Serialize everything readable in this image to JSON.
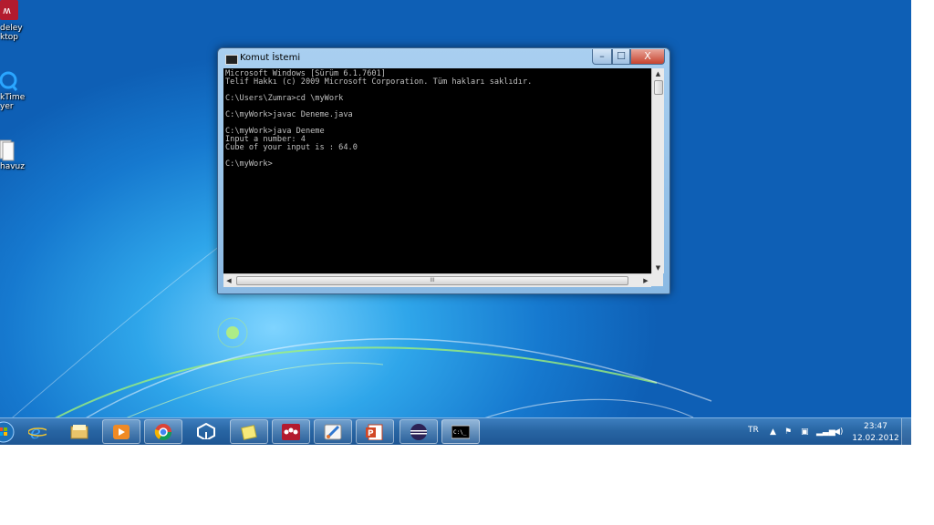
{
  "desktop_icons": [
    {
      "label": "deley\nktop",
      "icon": "mendeley-desktop-icon"
    },
    {
      "label": "kTime\nyer",
      "icon": "quicktime-player-icon"
    },
    {
      "label": "havuz",
      "icon": "folder-icon"
    }
  ],
  "window": {
    "title": "Komut İstemi",
    "icon": "console-icon",
    "console_text": "Microsoft Windows [Sürüm 6.1.7601]\nTelif Hakkı (c) 2009 Microsoft Corporation. Tüm hakları saklıdır.\n\nC:\\Users\\Zumra>cd \\myWork\n\nC:\\myWork>javac Deneme.java\n\nC:\\myWork>java Deneme\nInput a number: 4\nCube of your input is : 64.0\n\nC:\\myWork>",
    "controls": {
      "minimize": "–",
      "maximize": "☐",
      "close": "X"
    },
    "scroll": {
      "up": "▲",
      "down": "▼",
      "left": "◀",
      "right": "▶",
      "grip": "III"
    }
  },
  "taskbar": {
    "pinned": [
      {
        "name": "start-button"
      },
      {
        "name": "internet-explorer"
      },
      {
        "name": "windows-explorer"
      },
      {
        "name": "media-player"
      },
      {
        "name": "google-chrome"
      },
      {
        "name": "unity"
      },
      {
        "name": "sticky-notes"
      },
      {
        "name": "mendeley"
      },
      {
        "name": "paint-app"
      },
      {
        "name": "powerpoint"
      },
      {
        "name": "eclipse"
      },
      {
        "name": "command-prompt"
      }
    ],
    "tray": {
      "language": "TR",
      "time": "23:47",
      "date": "12.02.2012"
    }
  }
}
